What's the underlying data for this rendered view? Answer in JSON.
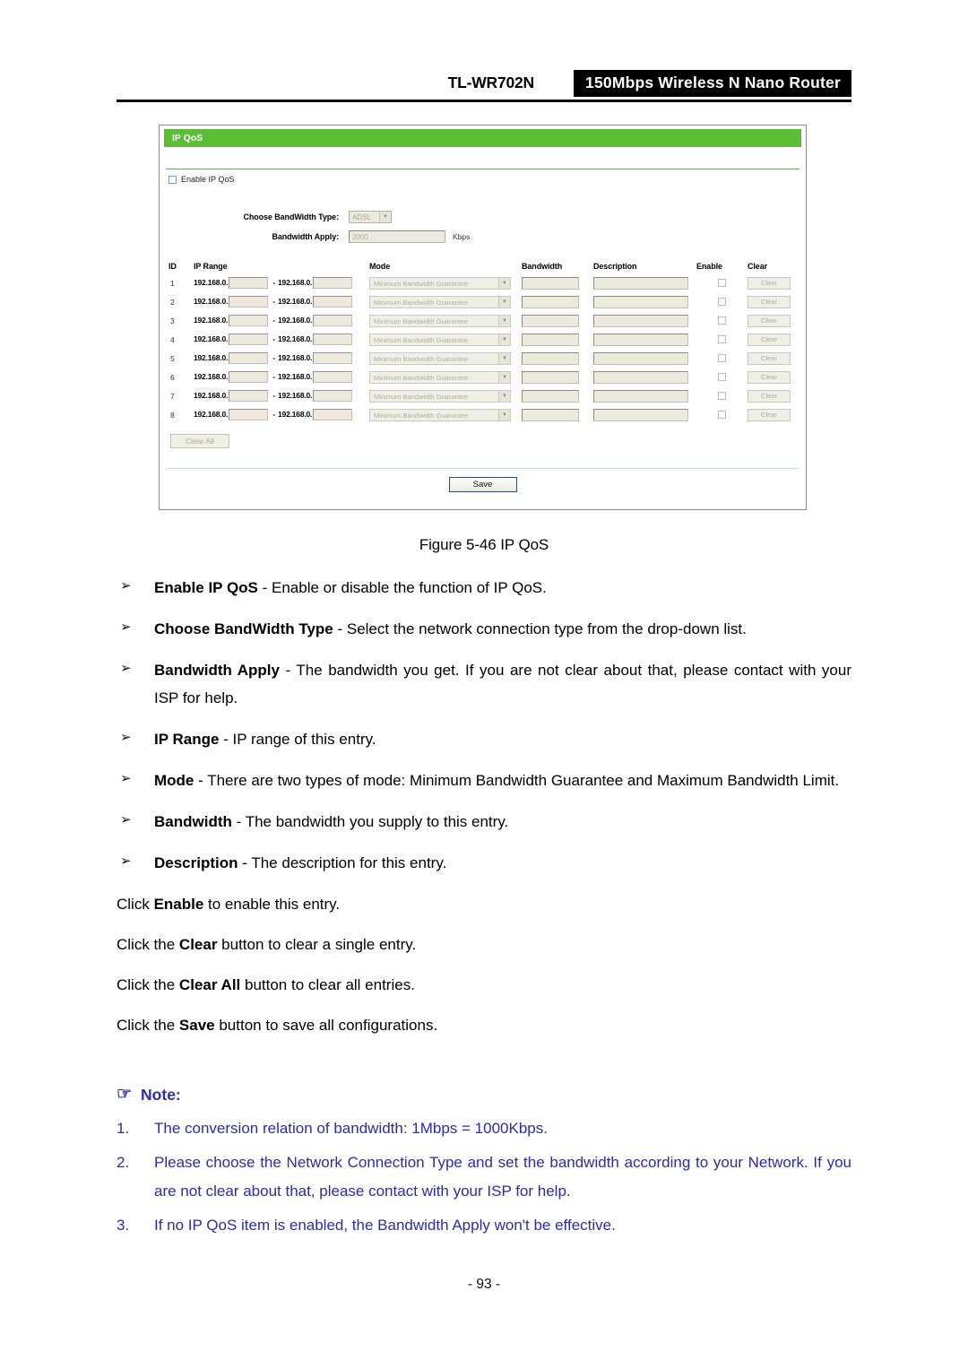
{
  "header": {
    "model": "TL-WR702N",
    "tagline": "150Mbps Wireless N Nano Router"
  },
  "screenshot": {
    "panel_title": "IP QoS",
    "enable_checkbox_label": "Enable IP QoS",
    "accent_color": "#5cbe35",
    "fields": [
      {
        "label": "Choose BandWidth Type:",
        "value": "ADSL",
        "control": "select"
      },
      {
        "label": "Bandwidth Apply:",
        "value": "2000",
        "unit": "Kbps",
        "control": "text"
      }
    ],
    "table": {
      "columns": [
        "ID",
        "IP Range",
        "Mode",
        "Bandwidth",
        "Description",
        "Enable",
        "Clear"
      ],
      "ip_prefix_start": "192.168.0.",
      "ip_prefix_end": "192.168.0.",
      "range_separator": "-",
      "mode_value": "Minimum Bandwidth Guarantee",
      "clear_label": "Clear",
      "rows": [
        {
          "id": "1"
        },
        {
          "id": "2"
        },
        {
          "id": "3"
        },
        {
          "id": "4"
        },
        {
          "id": "5"
        },
        {
          "id": "6"
        },
        {
          "id": "7"
        },
        {
          "id": "8"
        }
      ]
    },
    "clear_all_label": "Clear All",
    "save_label": "Save"
  },
  "figure_caption": "Figure 5-46 IP QoS",
  "bullets": [
    {
      "glyph": "➢",
      "term": "Enable IP QoS",
      "sep": " - ",
      "desc": "Enable or disable the function of IP QoS."
    },
    {
      "glyph": "➢",
      "term": "Choose BandWidth Type",
      "sep": " - ",
      "desc": "Select the network connection type from the drop-down list."
    },
    {
      "glyph": "➢",
      "term": "Bandwidth Apply",
      "sep": " - ",
      "desc": "The bandwidth you get. If you are not clear about that, please contact with your ISP for help."
    },
    {
      "glyph": "➢",
      "term": "IP Range",
      "sep": " - ",
      "desc": "IP range of this entry."
    },
    {
      "glyph": "➢",
      "term": "Mode",
      "sep": " - ",
      "desc": "There are two types of mode: Minimum Bandwidth Guarantee and Maximum Bandwidth Limit."
    },
    {
      "glyph": "➢",
      "term": "Bandwidth",
      "sep": " - ",
      "desc": "The bandwidth you supply to this entry."
    },
    {
      "glyph": "➢",
      "term": "Description",
      "sep": " - ",
      "desc": "The description for this entry."
    }
  ],
  "instructions": [
    {
      "pre": "Click ",
      "strong": "Enable",
      "post": " to enable this entry."
    },
    {
      "pre": "Click the ",
      "strong": "Clear",
      "post": " button to clear a single entry."
    },
    {
      "pre": "Click the ",
      "strong": "Clear All",
      "post": " button to clear all entries."
    },
    {
      "pre": "Click the ",
      "strong": "Save",
      "post": " button to save all configurations."
    }
  ],
  "note": {
    "hand_glyph": "☞",
    "title": "Note:",
    "color": "#2b2bb0",
    "items": [
      {
        "num": "1.",
        "text": "The conversion relation of bandwidth: 1Mbps = 1000Kbps."
      },
      {
        "num": "2.",
        "text": "Please choose the Network Connection Type and set the bandwidth according to your Network. If you are not clear about that, please contact with your ISP for help."
      },
      {
        "num": "3.",
        "text": "If no IP QoS item is enabled, the Bandwidth Apply won't be effective."
      }
    ]
  },
  "page_number": "- 93 -"
}
